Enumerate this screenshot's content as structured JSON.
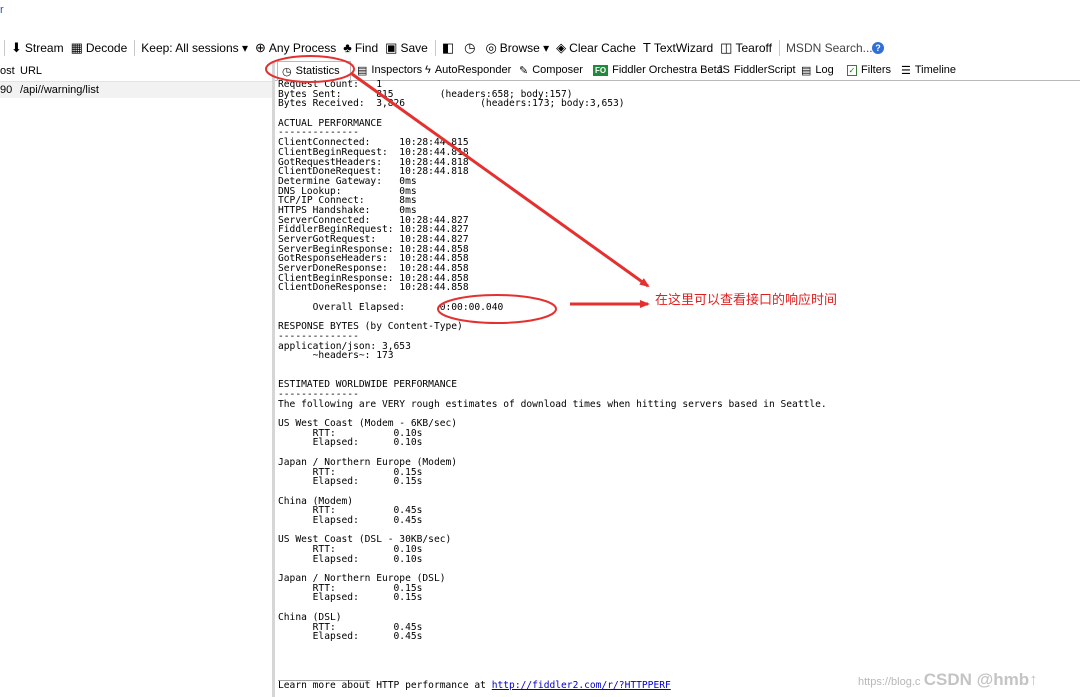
{
  "top_stub": "r",
  "toolbar": {
    "items": [
      {
        "name": "stream-button",
        "icon": "stream-icon",
        "glyph": "⬇",
        "label": "Stream"
      },
      {
        "name": "decode-button",
        "icon": "decode-icon",
        "glyph": "▦",
        "label": "Decode"
      },
      {
        "name": "keep-sessions-dropdown",
        "icon": "",
        "glyph": "",
        "label": "Keep: All sessions ▾"
      },
      {
        "name": "any-process-button",
        "icon": "crosshair-icon",
        "glyph": "⊕",
        "label": "Any Process"
      },
      {
        "name": "find-button",
        "icon": "binoculars-icon",
        "glyph": "♣",
        "label": "Find"
      },
      {
        "name": "save-button",
        "icon": "save-icon",
        "glyph": "▣",
        "label": "Save"
      },
      {
        "name": "screenshot-button",
        "icon": "camera-icon",
        "glyph": "◧",
        "label": ""
      },
      {
        "name": "timer-button",
        "icon": "timer-icon",
        "glyph": "◷",
        "label": ""
      },
      {
        "name": "browse-button",
        "icon": "globe-icon",
        "glyph": "◎",
        "label": "Browse ▾"
      },
      {
        "name": "clear-cache-button",
        "icon": "eraser-icon",
        "glyph": "◈",
        "label": "Clear Cache"
      },
      {
        "name": "textwizard-button",
        "icon": "textwizard-icon",
        "glyph": "T",
        "label": "TextWizard"
      },
      {
        "name": "tearoff-button",
        "icon": "tearoff-icon",
        "glyph": "◫",
        "label": "Tearoff"
      }
    ],
    "search_placeholder": "MSDN Search...",
    "help": "?"
  },
  "left": {
    "col_host": "ost",
    "col_url": "URL",
    "row_host": "90",
    "row_url": "/api//warning/list"
  },
  "tabs": [
    {
      "name": "tab-statistics",
      "icon": "stopwatch-icon",
      "glyph": "◷",
      "label": "Statistics",
      "active": true
    },
    {
      "name": "tab-inspectors",
      "icon": "inspectors-icon",
      "glyph": "▤",
      "label": "Inspectors",
      "active": false
    },
    {
      "name": "tab-autoresponder",
      "icon": "lightning-icon",
      "glyph": "ϟ",
      "label": "AutoResponder",
      "active": false
    },
    {
      "name": "tab-composer",
      "icon": "pencil-icon",
      "glyph": "✎",
      "label": "Composer",
      "active": false
    },
    {
      "name": "tab-fiddler-orchestra",
      "icon": "fo-icon",
      "glyph": "FO",
      "label": "Fiddler Orchestra Beta",
      "active": false
    },
    {
      "name": "tab-fiddlerscript",
      "icon": "script-icon",
      "glyph": "JS",
      "label": "FiddlerScript",
      "active": false
    },
    {
      "name": "tab-log",
      "icon": "log-icon",
      "glyph": "▤",
      "label": "Log",
      "active": false
    },
    {
      "name": "tab-filters",
      "icon": "checkbox-icon",
      "glyph": "✓",
      "label": "Filters",
      "active": false
    },
    {
      "name": "tab-timeline",
      "icon": "timeline-icon",
      "glyph": "☰",
      "label": "Timeline",
      "active": false
    }
  ],
  "stats_lines": [
    "Request Count:   1",
    "Bytes Sent:      815        (headers:658; body:157)",
    "Bytes Received:  3,826             (headers:173; body:3,653)",
    "",
    "ACTUAL PERFORMANCE",
    "--------------",
    "ClientConnected:     10:28:44.815",
    "ClientBeginRequest:  10:28:44.818",
    "GotRequestHeaders:   10:28:44.818",
    "ClientDoneRequest:   10:28:44.818",
    "Determine Gateway:   0ms",
    "DNS Lookup:          0ms",
    "TCP/IP Connect:      8ms",
    "HTTPS Handshake:     0ms",
    "ServerConnected:     10:28:44.827",
    "FiddlerBeginRequest: 10:28:44.827",
    "ServerGotRequest:    10:28:44.827",
    "ServerBeginResponse: 10:28:44.858",
    "GotResponseHeaders:  10:28:44.858",
    "ServerDoneResponse:  10:28:44.858",
    "ClientBeginResponse: 10:28:44.858",
    "ClientDoneResponse:  10:28:44.858",
    "",
    "      Overall Elapsed:      0:00:00.040",
    "",
    "RESPONSE BYTES (by Content-Type)",
    "--------------",
    "application/json: 3,653",
    "      ~headers~: 173",
    "",
    "",
    "ESTIMATED WORLDWIDE PERFORMANCE",
    "--------------",
    "The following are VERY rough estimates of download times when hitting servers based in Seattle.",
    "",
    "US West Coast (Modem - 6KB/sec)",
    "      RTT:          0.10s",
    "      Elapsed:      0.10s",
    "",
    "Japan / Northern Europe (Modem)",
    "      RTT:          0.15s",
    "      Elapsed:      0.15s",
    "",
    "China (Modem)",
    "      RTT:          0.45s",
    "      Elapsed:      0.45s",
    "",
    "US West Coast (DSL - 30KB/sec)",
    "      RTT:          0.10s",
    "      Elapsed:      0.10s",
    "",
    "Japan / Northern Europe (DSL)",
    "      RTT:          0.15s",
    "      Elapsed:      0.15s",
    "",
    "China (DSL)",
    "      RTT:          0.45s",
    "      Elapsed:      0.45s",
    "",
    "",
    "",
    "________________"
  ],
  "footer": {
    "prefix": "Learn more about HTTP performance at ",
    "link": "http://fiddler2.com/r/?HTTPPERF"
  },
  "annotation": "在这里可以查看接口的响应时间",
  "watermark": {
    "site": "https://blog.c",
    "brand": "CSDN @hmb↑"
  },
  "colors": {
    "annotation": "#e02020",
    "link": "#0000cc"
  }
}
